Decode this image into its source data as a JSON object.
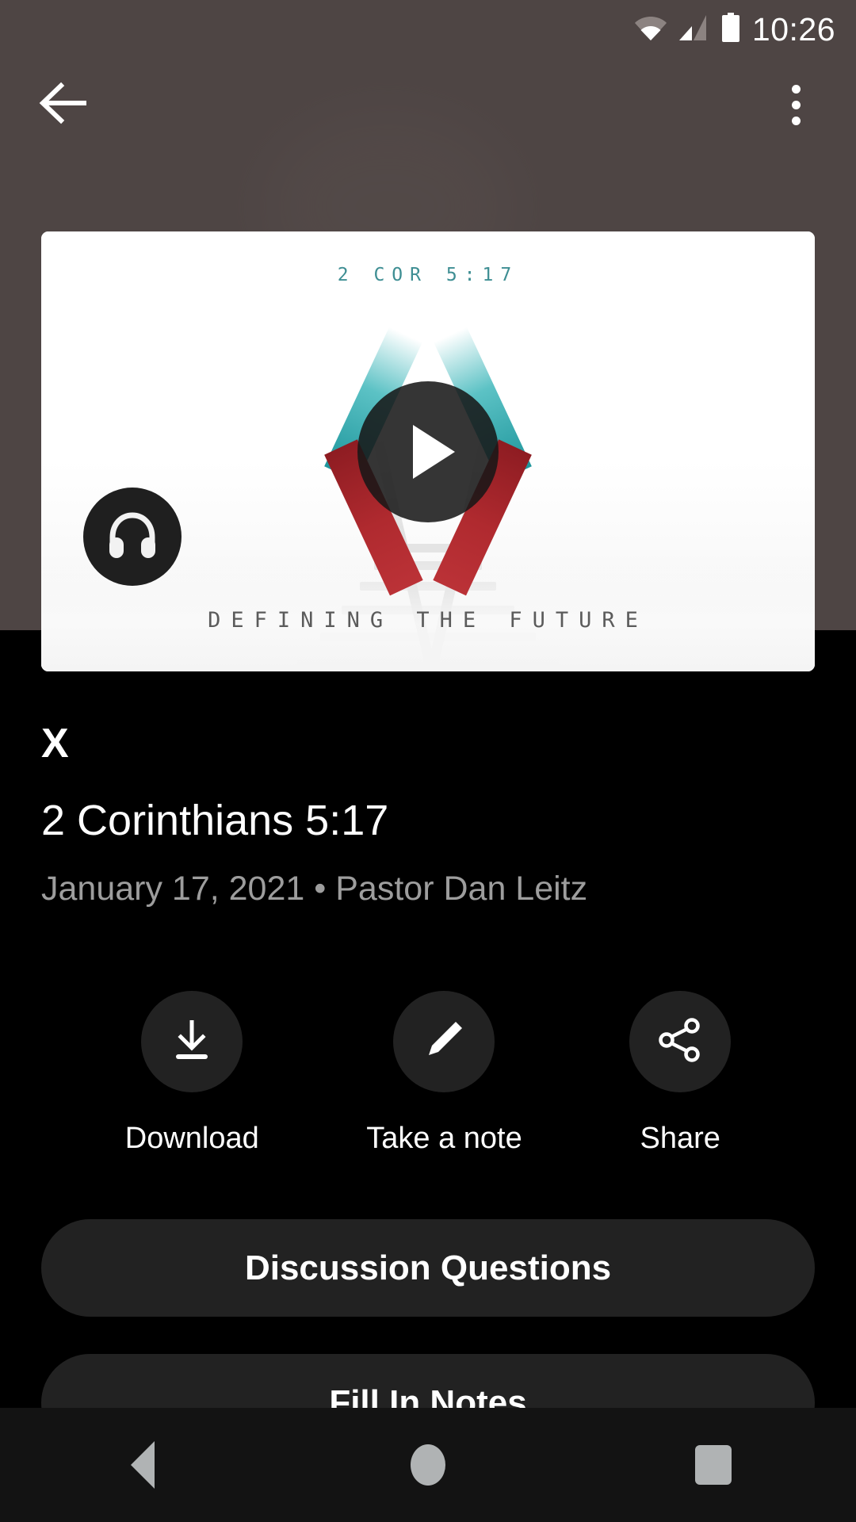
{
  "status_bar": {
    "time": "10:26",
    "icons": [
      "wifi-icon",
      "cellular-signal-icon",
      "battery-icon"
    ]
  },
  "app_bar": {
    "back_icon": "arrow-back-icon",
    "overflow_icon": "more-vertical-icon"
  },
  "thumbnail": {
    "verse_reference": "2 COR 5:17",
    "tagline": "DEFINING THE FUTURE",
    "play_icon": "play-icon",
    "audio_icon": "headphones-icon",
    "colors": {
      "teal": "#2fa3a8",
      "red": "#b02a2f",
      "card_background": "#fdfdfd"
    }
  },
  "details": {
    "series": "X",
    "title": "2 Corinthians 5:17",
    "meta": "January 17, 2021 • Pastor Dan Leitz"
  },
  "actions": [
    {
      "label": "Download",
      "icon": "download-icon"
    },
    {
      "label": "Take a note",
      "icon": "pencil-icon"
    },
    {
      "label": "Share",
      "icon": "share-icon"
    }
  ],
  "buttons": [
    {
      "label": "Discussion Questions"
    },
    {
      "label": "Fill In Notes"
    }
  ],
  "navigation_bar": {
    "back": "nav-back-icon",
    "home": "nav-home-icon",
    "recents": "nav-recents-icon"
  },
  "theme": {
    "background": "#000000",
    "scrim": "#4e4544",
    "surface": "#222222",
    "text_primary": "#ffffff",
    "text_secondary": "#9d9d9d"
  }
}
